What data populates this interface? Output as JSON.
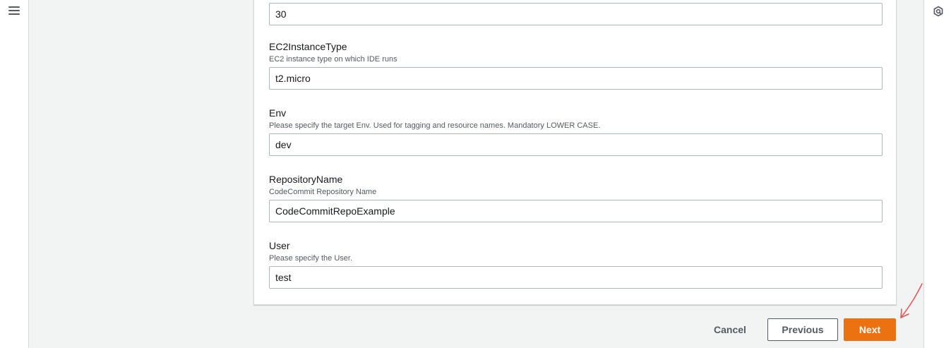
{
  "nav": {
    "menu_icon": "hamburger-menu-icon",
    "right_icon": "cloudshell-hexagon-icon"
  },
  "fields": [
    {
      "name": "",
      "description": "",
      "value": "30"
    },
    {
      "name": "EC2InstanceType",
      "description": "EC2 instance type on which IDE runs",
      "value": "t2.micro"
    },
    {
      "name": "Env",
      "description": "Please specify the target Env. Used for tagging and resource names. Mandatory LOWER CASE.",
      "value": "dev"
    },
    {
      "name": "RepositoryName",
      "description": "CodeCommit Repository Name",
      "value": "CodeCommitRepoExample"
    },
    {
      "name": "User",
      "description": "Please specify the User.",
      "value": "test"
    }
  ],
  "actions": {
    "cancel": "Cancel",
    "previous": "Previous",
    "next": "Next"
  },
  "colors": {
    "primary": "#ec7211",
    "annotation_arrow": "#e05a5a",
    "background": "#f2f3f3"
  }
}
